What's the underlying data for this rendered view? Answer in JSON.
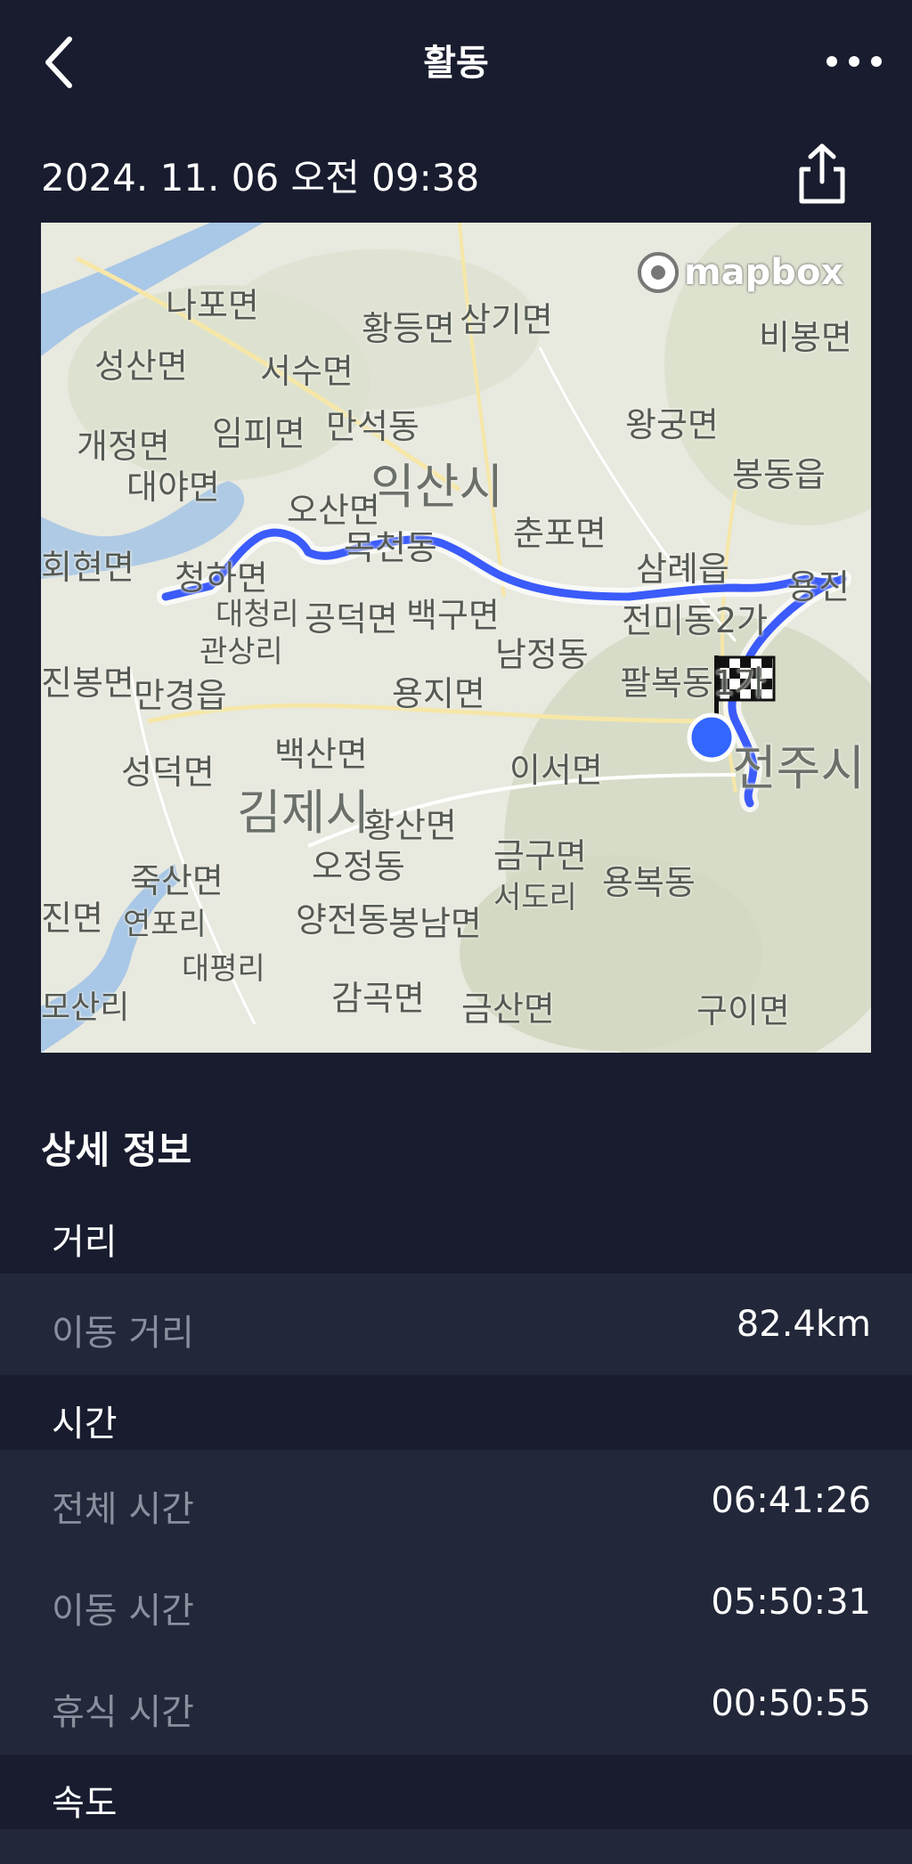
{
  "header": {
    "title": "활동"
  },
  "activity": {
    "datetime": "2024. 11. 06 오전 09:38"
  },
  "map": {
    "attribution": "mapbox",
    "labels": [
      "나포면",
      "황등면",
      "삼기면",
      "비봉면",
      "성산면",
      "서수면",
      "왕궁면",
      "개정면",
      "임피면",
      "만석동",
      "봉동읍",
      "대야면",
      "익산시",
      "오산면",
      "춘포면",
      "회현면",
      "목천동",
      "삼례읍",
      "용진",
      "청하면",
      "대청리",
      "공덕면",
      "백구면",
      "전미동2가",
      "관상리",
      "남정동",
      "진봉면",
      "만경읍",
      "용지면",
      "팔복동1가",
      "성덕면",
      "백산면",
      "이서면",
      "전주시",
      "김제시",
      "황산면",
      "죽산면",
      "오정동",
      "금구면",
      "용복동",
      "진면",
      "연포리",
      "양전동",
      "봉남면",
      "서도리",
      "대평리",
      "모산리",
      "감곡면",
      "금산면",
      "구이면"
    ]
  },
  "details": {
    "title": "상세 정보",
    "distance": {
      "header": "거리",
      "rows": [
        {
          "label": "이동 거리",
          "value": "82.4km"
        }
      ]
    },
    "time": {
      "header": "시간",
      "rows": [
        {
          "label": "전체 시간",
          "value": "06:41:26"
        },
        {
          "label": "이동 시간",
          "value": "05:50:31"
        },
        {
          "label": "휴식 시간",
          "value": "00:50:55"
        }
      ]
    },
    "speed": {
      "header": "속도"
    }
  },
  "colors": {
    "background": "#181c2e",
    "row_background": "#222739",
    "route": "#3b5bfa",
    "start_marker": "#3366ff"
  }
}
